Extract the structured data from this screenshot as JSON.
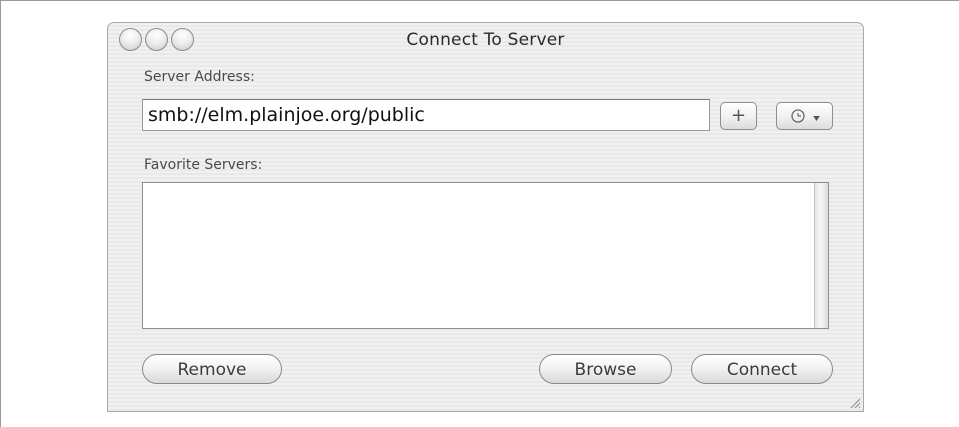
{
  "window": {
    "title": "Connect To Server"
  },
  "form": {
    "server_address_label": "Server Address:",
    "server_address_value": "smb://elm.plainjoe.org/public",
    "add_label": "+",
    "favorites_label": "Favorite Servers:",
    "favorites": []
  },
  "buttons": {
    "remove_label": "Remove",
    "browse_label": "Browse",
    "connect_label": "Connect"
  },
  "icons": {
    "close": "close-icon",
    "minimize": "minimize-icon",
    "zoom": "zoom-icon",
    "recent_servers": "clock-icon",
    "resize": "resize-grip-icon"
  }
}
